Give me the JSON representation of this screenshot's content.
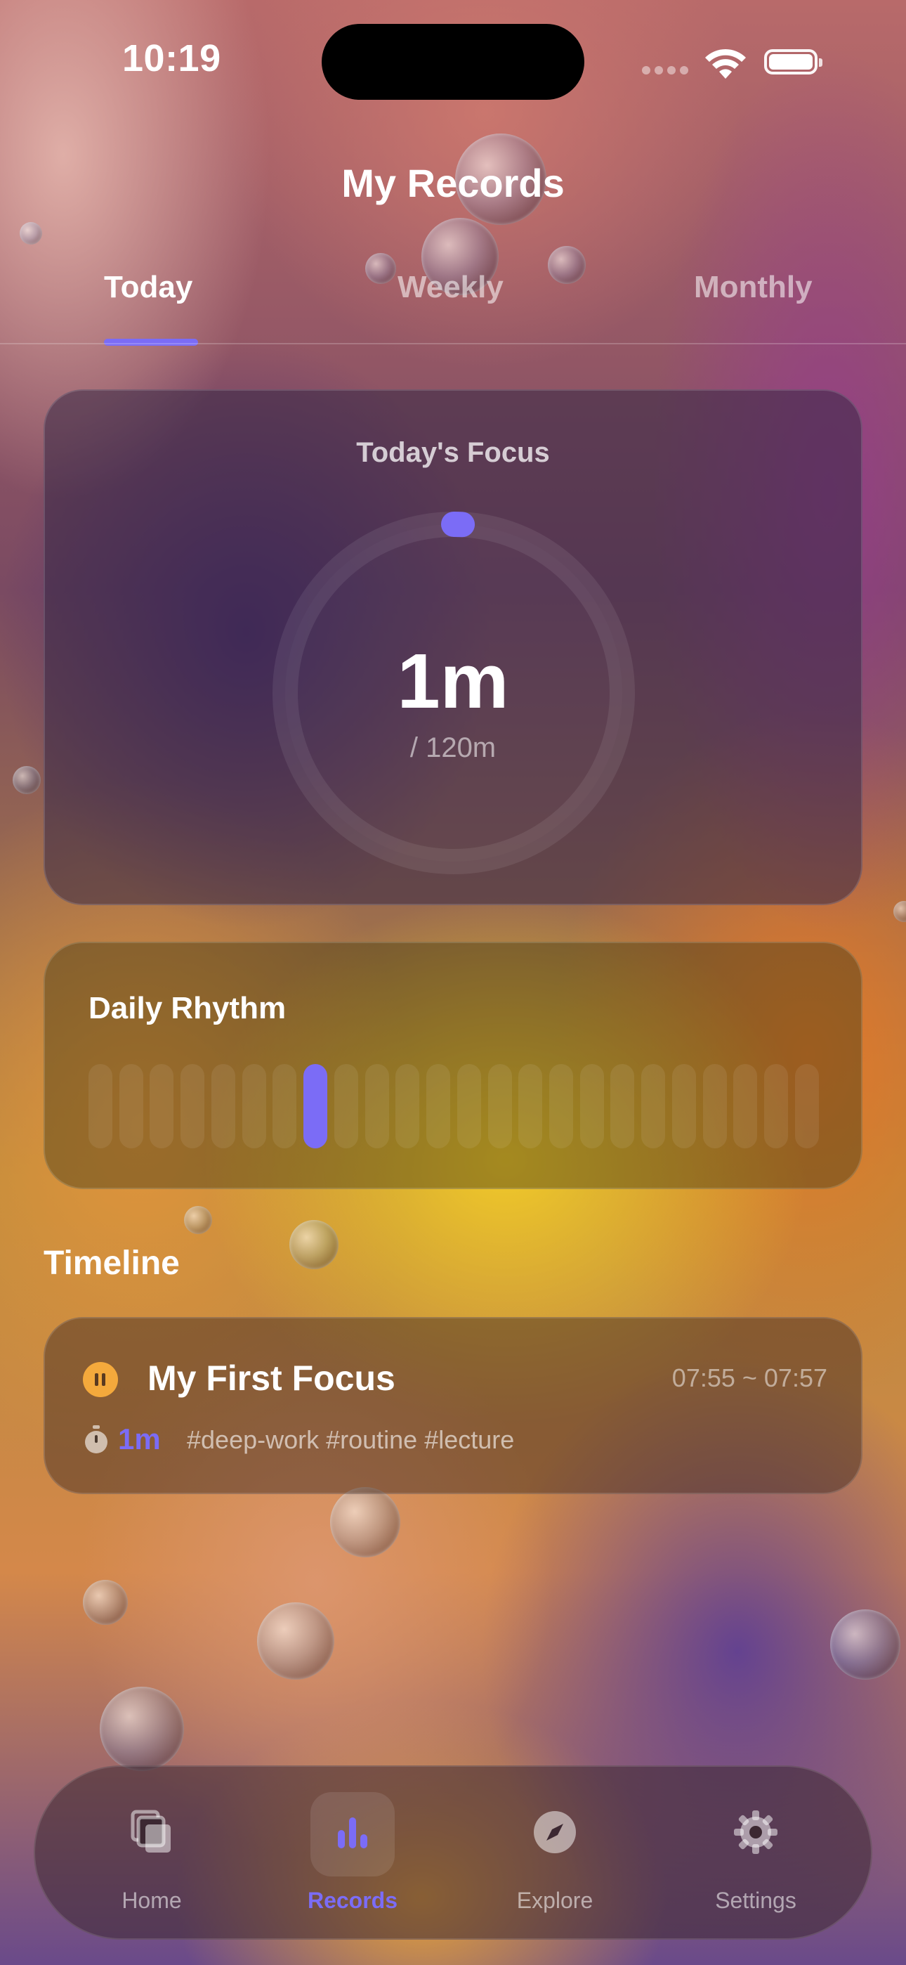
{
  "status_bar": {
    "time": "10:19"
  },
  "header": {
    "title": "My Records"
  },
  "tabs": [
    {
      "label": "Today",
      "selected": true
    },
    {
      "label": "Weekly",
      "selected": false
    },
    {
      "label": "Monthly",
      "selected": false
    }
  ],
  "focus_card": {
    "title": "Today's Focus",
    "value": "1m",
    "goal": "/ 120m",
    "progress_fraction": 0.008
  },
  "rhythm_card": {
    "title": "Daily Rhythm",
    "bar_count": 24,
    "active_hour_index": 7
  },
  "timeline": {
    "section_title": "Timeline",
    "entries": [
      {
        "name": "My First Focus",
        "time_range": "07:55 ~ 07:57",
        "duration": "1m",
        "tags": "#deep-work #routine #lecture",
        "status_icon": "pause-icon"
      }
    ]
  },
  "bottom_nav": {
    "items": [
      {
        "label": "Home",
        "icon": "cards-icon",
        "selected": false
      },
      {
        "label": "Records",
        "icon": "bar-chart-icon",
        "selected": true
      },
      {
        "label": "Explore",
        "icon": "compass-icon",
        "selected": false
      },
      {
        "label": "Settings",
        "icon": "gear-icon",
        "selected": false
      }
    ]
  },
  "colors": {
    "accent": "#7b6cf6",
    "status_orange": "#f4a93c"
  }
}
